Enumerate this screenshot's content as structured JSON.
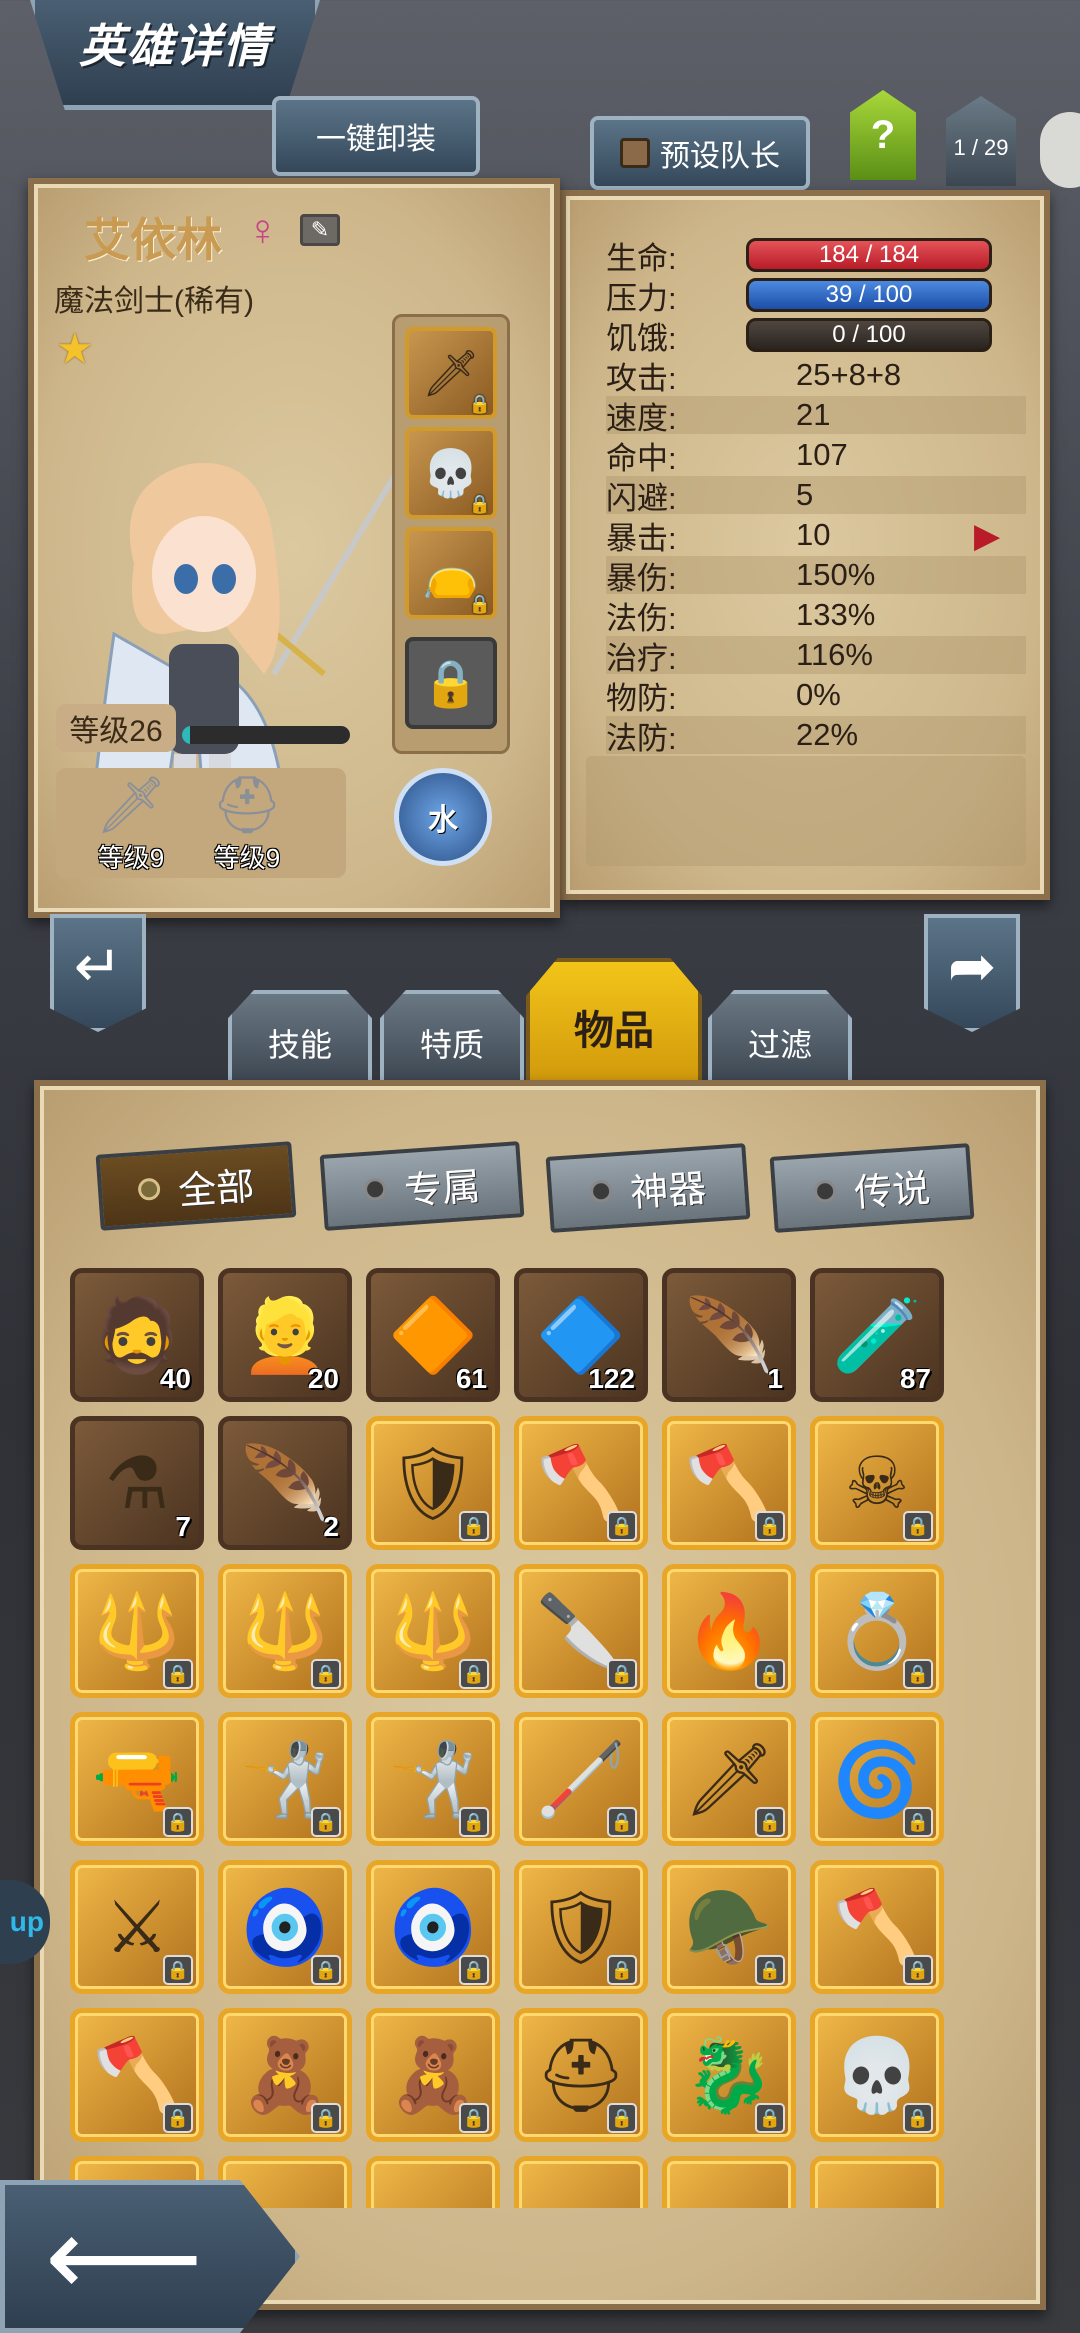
{
  "header": {
    "title": "英雄详情"
  },
  "top_bar": {
    "unequip_all": "一键卸装",
    "preset_leader": "预设队长",
    "help": "?",
    "page": "1 / 29"
  },
  "hero": {
    "name": "艾依林",
    "gender_icon": "female-icon",
    "class": "魔法剑士(稀有)",
    "stars": 1,
    "level_label": "等级26",
    "xp_fraction": 0.05,
    "element": "水",
    "gear": [
      {
        "icon": "sword-icon",
        "level": "等级9"
      },
      {
        "icon": "helmet-icon",
        "level": "等级9"
      }
    ],
    "equip_slots": [
      {
        "icon": "sword-icon",
        "glyph": "🗡"
      },
      {
        "icon": "skull-mace-icon",
        "glyph": "💀"
      },
      {
        "icon": "pouch-icon",
        "glyph": "👝"
      },
      {
        "icon": "lock-icon",
        "glyph": "🔒"
      }
    ]
  },
  "stats": {
    "hp": {
      "label": "生命:",
      "value": "184 / 184"
    },
    "stress": {
      "label": "压力:",
      "value": "39 / 100"
    },
    "hunger": {
      "label": "饥饿:",
      "value": "0 / 100"
    },
    "rows": [
      {
        "label": "攻击:",
        "value": "25+8+8"
      },
      {
        "label": "速度:",
        "value": "21"
      },
      {
        "label": "命中:",
        "value": "107"
      },
      {
        "label": "闪避:",
        "value": "5"
      },
      {
        "label": "暴击:",
        "value": "10"
      },
      {
        "label": "暴伤:",
        "value": "150%"
      },
      {
        "label": "法伤:",
        "value": "133%"
      },
      {
        "label": "治疗:",
        "value": "116%"
      },
      {
        "label": "物防:",
        "value": "0%"
      },
      {
        "label": "法防:",
        "value": "22%"
      }
    ]
  },
  "tabs": [
    {
      "label": "技能"
    },
    {
      "label": "特质"
    },
    {
      "label": "物品"
    },
    {
      "label": "过滤"
    }
  ],
  "filters": [
    {
      "label": "全部"
    },
    {
      "label": "专属"
    },
    {
      "label": "神器"
    },
    {
      "label": "传说"
    }
  ],
  "side_tab": "up",
  "items": [
    {
      "glyph": "🧔",
      "count": "40",
      "gold": false,
      "locked": false,
      "icon": "hero-portrait-icon"
    },
    {
      "glyph": "👱",
      "count": "20",
      "gold": false,
      "locked": false,
      "icon": "hero-portrait-icon"
    },
    {
      "glyph": "🔶",
      "count": "61",
      "gold": false,
      "locked": false,
      "icon": "fire-gem-icon"
    },
    {
      "glyph": "🔷",
      "count": "122",
      "gold": false,
      "locked": false,
      "icon": "water-gem-icon"
    },
    {
      "glyph": "🪶",
      "count": "1",
      "gold": false,
      "locked": false,
      "icon": "phoenix-feather-icon"
    },
    {
      "glyph": "🧪",
      "count": "87",
      "gold": false,
      "locked": false,
      "icon": "potion-icon"
    },
    {
      "glyph": "⚗",
      "count": "7",
      "gold": false,
      "locked": false,
      "icon": "mana-potion-icon"
    },
    {
      "glyph": "🪶",
      "count": "2",
      "gold": false,
      "locked": false,
      "icon": "feather-icon"
    },
    {
      "glyph": "🛡",
      "count": "",
      "gold": true,
      "locked": true,
      "icon": "shield-icon"
    },
    {
      "glyph": "🪓",
      "count": "",
      "gold": true,
      "locked": true,
      "icon": "axe-icon"
    },
    {
      "glyph": "🪓",
      "count": "",
      "gold": true,
      "locked": true,
      "icon": "axe-icon"
    },
    {
      "glyph": "☠",
      "count": "",
      "gold": true,
      "locked": true,
      "icon": "skull-cloak-icon"
    },
    {
      "glyph": "🔱",
      "count": "",
      "gold": true,
      "locked": true,
      "icon": "spear-icon"
    },
    {
      "glyph": "🔱",
      "count": "",
      "gold": true,
      "locked": true,
      "icon": "spear-icon"
    },
    {
      "glyph": "🔱",
      "count": "",
      "gold": true,
      "locked": true,
      "icon": "spear-icon"
    },
    {
      "glyph": "🔪",
      "count": "",
      "gold": true,
      "locked": true,
      "icon": "cleaver-icon"
    },
    {
      "glyph": "🔥",
      "count": "",
      "gold": true,
      "locked": true,
      "icon": "flame-sword-icon"
    },
    {
      "glyph": "💍",
      "count": "",
      "gold": true,
      "locked": true,
      "icon": "ring-icon"
    },
    {
      "glyph": "🔫",
      "count": "",
      "gold": true,
      "locked": true,
      "icon": "pistol-icon"
    },
    {
      "glyph": "🤺",
      "count": "",
      "gold": true,
      "locked": true,
      "icon": "rapier-icon"
    },
    {
      "glyph": "🤺",
      "count": "",
      "gold": true,
      "locked": true,
      "icon": "rapier-icon"
    },
    {
      "glyph": "🦯",
      "count": "",
      "gold": true,
      "locked": true,
      "icon": "staff-icon"
    },
    {
      "glyph": "🗡",
      "count": "",
      "gold": true,
      "locked": true,
      "icon": "dagger-icon"
    },
    {
      "glyph": "🌀",
      "count": "",
      "gold": true,
      "locked": true,
      "icon": "water-staff-icon"
    },
    {
      "glyph": "⚔",
      "count": "",
      "gold": true,
      "locked": true,
      "icon": "sword-icon"
    },
    {
      "glyph": "🧿",
      "count": "",
      "gold": true,
      "locked": true,
      "icon": "amulet-icon"
    },
    {
      "glyph": "🧿",
      "count": "",
      "gold": true,
      "locked": true,
      "icon": "amulet-icon"
    },
    {
      "glyph": "🛡",
      "count": "",
      "gold": true,
      "locked": true,
      "icon": "shield-icon"
    },
    {
      "glyph": "🪖",
      "count": "",
      "gold": true,
      "locked": true,
      "icon": "helmet-icon"
    },
    {
      "glyph": "🪓",
      "count": "",
      "gold": true,
      "locked": true,
      "icon": "heart-axe-icon"
    },
    {
      "glyph": "🪓",
      "count": "",
      "gold": true,
      "locked": true,
      "icon": "heart-axe-icon"
    },
    {
      "glyph": "🧸",
      "count": "",
      "gold": true,
      "locked": true,
      "icon": "voodoo-doll-icon"
    },
    {
      "glyph": "🧸",
      "count": "",
      "gold": true,
      "locked": true,
      "icon": "voodoo-doll-icon"
    },
    {
      "glyph": "⛑",
      "count": "",
      "gold": true,
      "locked": true,
      "icon": "knight-helmet-icon"
    },
    {
      "glyph": "🐉",
      "count": "",
      "gold": true,
      "locked": true,
      "icon": "dragon-ring-icon"
    },
    {
      "glyph": "💀",
      "count": "",
      "gold": true,
      "locked": true,
      "icon": "skull-mace-icon"
    },
    {
      "glyph": "",
      "count": "",
      "gold": true,
      "locked": false,
      "icon": "item-icon"
    },
    {
      "glyph": "",
      "count": "",
      "gold": true,
      "locked": false,
      "icon": "item-icon"
    },
    {
      "glyph": "",
      "count": "",
      "gold": true,
      "locked": false,
      "icon": "item-icon"
    },
    {
      "glyph": "",
      "count": "",
      "gold": true,
      "locked": false,
      "icon": "item-icon"
    },
    {
      "glyph": "",
      "count": "",
      "gold": true,
      "locked": false,
      "icon": "item-icon"
    },
    {
      "glyph": "",
      "count": "",
      "gold": true,
      "locked": false,
      "icon": "item-icon"
    }
  ]
}
